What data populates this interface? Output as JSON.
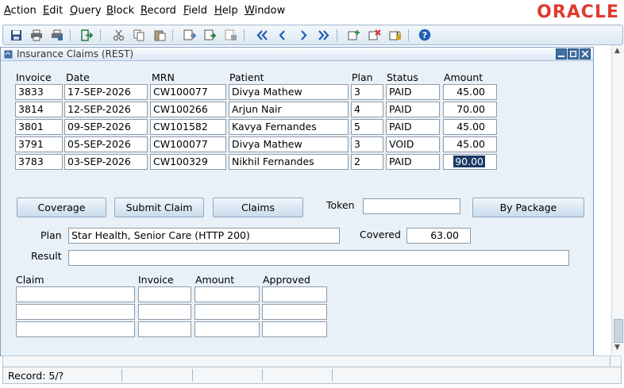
{
  "menu": {
    "items": [
      {
        "u": "A",
        "rest": "ction"
      },
      {
        "u": "E",
        "rest": "dit"
      },
      {
        "u": "Q",
        "rest": "uery"
      },
      {
        "u": "B",
        "rest": "lock"
      },
      {
        "u": "R",
        "rest": "ecord"
      },
      {
        "u": "F",
        "rest": "ield"
      },
      {
        "u": "H",
        "rest": "elp"
      },
      {
        "u": "W",
        "rest": "indow"
      }
    ],
    "logo": "ORACLE"
  },
  "window": {
    "title": "Insurance Claims (REST)"
  },
  "invoices": {
    "headers": [
      "Invoice",
      "Date",
      "MRN",
      "Patient",
      "Plan",
      "Status",
      "Amount"
    ],
    "rows": [
      [
        "3833",
        "17-SEP-2026",
        "CW100077",
        "Divya Mathew",
        "3",
        "PAID",
        "45.00"
      ],
      [
        "3814",
        "12-SEP-2026",
        "CW100266",
        "Arjun Nair",
        "4",
        "PAID",
        "70.00"
      ],
      [
        "3801",
        "09-SEP-2026",
        "CW101582",
        "Kavya Fernandes",
        "5",
        "PAID",
        "45.00"
      ],
      [
        "3791",
        "05-SEP-2026",
        "CW100077",
        "Divya Mathew",
        "3",
        "VOID",
        "45.00"
      ],
      [
        "3783",
        "03-SEP-2026",
        "CW100329",
        "Nikhil Fernandes",
        "2",
        "PAID",
        "90.00"
      ]
    ]
  },
  "actions": {
    "coverage": "Coverage",
    "submit_claim": "Submit Claim",
    "claims": "Claims",
    "token_label": "Token",
    "token_value": "",
    "by_package": "By Package"
  },
  "plan": {
    "label": "Plan",
    "value": "Star Health, Senior Care (HTTP 200)",
    "covered_label": "Covered",
    "covered_value": "63.00",
    "result_label": "Result",
    "result_value": ""
  },
  "claims_block": {
    "headers": [
      "Claim",
      "Invoice",
      "Amount",
      "Approved"
    ],
    "rows": [
      [
        "",
        "",
        "",
        ""
      ],
      [
        "",
        "",
        "",
        ""
      ],
      [
        "",
        "",
        "",
        ""
      ]
    ]
  },
  "status": {
    "record": "Record: 5/?"
  }
}
